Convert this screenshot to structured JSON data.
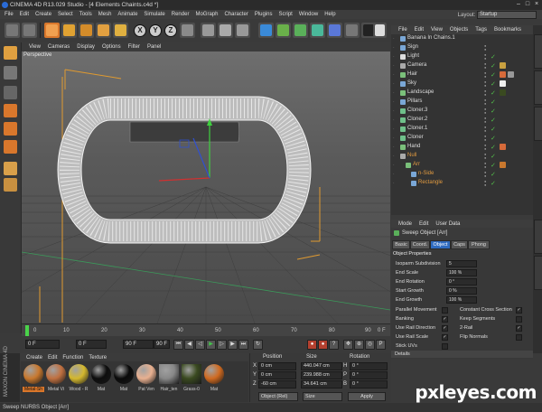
{
  "window": {
    "title": "CINEMA 4D R13.029 Studio - [4 Elements Chaints.c4d *]"
  },
  "menubar": {
    "items": [
      "File",
      "Edit",
      "Create",
      "Select",
      "Tools",
      "Mesh",
      "Animate",
      "Simulate",
      "Render",
      "MoGraph",
      "Character",
      "Plugins",
      "Script",
      "Window",
      "Help"
    ],
    "layout_label": "Layout:",
    "layout_value": "Startup"
  },
  "toolbar": {
    "axis_x": "X",
    "axis_y": "Y",
    "axis_z": "Z"
  },
  "viewport": {
    "menu": [
      "View",
      "Cameras",
      "Display",
      "Options",
      "Filter",
      "Panel"
    ],
    "label": "Perspective"
  },
  "timeline": {
    "ticks": [
      "0",
      "10",
      "20",
      "30",
      "40",
      "50",
      "60",
      "70",
      "80",
      "90"
    ],
    "end_marker": "0 F",
    "start_field": "0 F",
    "current_field": "0 F",
    "end_field": "90 F",
    "end_field2": "90 F"
  },
  "materials": {
    "menu": [
      "Create",
      "Edit",
      "Function",
      "Texture"
    ],
    "items": [
      {
        "name": "Metal-Sh",
        "color": "#c8782e",
        "selected": true
      },
      {
        "name": "Metal Vi",
        "color": "#c07040"
      },
      {
        "name": "Wood - R",
        "color": "#d4b82e"
      },
      {
        "name": "Mat",
        "color": "#0d0d0d"
      },
      {
        "name": "Mat",
        "color": "#0a0a0a"
      },
      {
        "name": "Pat Ven",
        "color": "#e8b090"
      },
      {
        "name": "Hair_ten",
        "color": "#888888"
      },
      {
        "name": "Grass-0",
        "color": "#3a4a20"
      },
      {
        "name": "Mat",
        "color": "#d06a20"
      }
    ],
    "brand": "MAXON CINEMA 4D"
  },
  "coordinates": {
    "headers": {
      "position": "Position",
      "size": "Size",
      "rotation": "Rotation"
    },
    "rows": [
      {
        "axis": "X",
        "pos": "0 cm",
        "size": "440.047 cm",
        "rot_axis": "H",
        "rot": "0 °"
      },
      {
        "axis": "Y",
        "pos": "0 cm",
        "size": "239.988 cm",
        "rot_axis": "P",
        "rot": "0 °"
      },
      {
        "axis": "Z",
        "pos": "-60 cm",
        "size": "34.641 cm",
        "rot_axis": "B",
        "rot": "0 °"
      }
    ],
    "mode_select": "Object (Rel)",
    "size_select": "Size",
    "apply_label": "Apply"
  },
  "status": {
    "text": "Sweep NURBS Object [Arr]"
  },
  "object_manager": {
    "menu": [
      "File",
      "Edit",
      "View",
      "Objects",
      "Tags",
      "Bookmarks"
    ],
    "objects": [
      {
        "name": "Banana In Chains.1",
        "indent": 0,
        "color": "#7aa7d6",
        "check": false
      },
      {
        "name": "Sign",
        "indent": 0,
        "color": "#7aa7d6",
        "check": false
      },
      {
        "name": "Light",
        "indent": 0,
        "color": "#ddd",
        "check": true
      },
      {
        "name": "Camera",
        "indent": 0,
        "color": "#aaa",
        "check": true
      },
      {
        "name": "Hair",
        "indent": 0,
        "color": "#7ac07a",
        "check": true
      },
      {
        "name": "Sky",
        "indent": 0,
        "color": "#7aa7d6",
        "check": true
      },
      {
        "name": "Landscape",
        "indent": 0,
        "color": "#7ac07a",
        "check": true
      },
      {
        "name": "Pillars",
        "indent": 0,
        "color": "#7aa7d6",
        "check": true
      },
      {
        "name": "Cloner.3",
        "indent": 0,
        "color": "#6fc08a",
        "check": true
      },
      {
        "name": "Cloner.2",
        "indent": 0,
        "color": "#6fc08a",
        "check": true
      },
      {
        "name": "Cloner.1",
        "indent": 0,
        "color": "#6fc08a",
        "check": true
      },
      {
        "name": "Cloner",
        "indent": 0,
        "color": "#6fc08a",
        "check": true
      },
      {
        "name": "Hand",
        "indent": 0,
        "color": "#7ac07a",
        "check": true
      },
      {
        "name": "Null",
        "indent": 0,
        "color": "#aaa",
        "check": true,
        "orange": true
      },
      {
        "name": "Arr",
        "indent": 1,
        "color": "#7ac07a",
        "check": true,
        "orange": true
      },
      {
        "name": "n-Side",
        "indent": 2,
        "color": "#7aa7d6",
        "check": true,
        "orange": true
      },
      {
        "name": "Rectangle",
        "indent": 2,
        "color": "#7aa7d6",
        "check": true,
        "orange": true
      }
    ]
  },
  "attributes": {
    "menu": [
      "Mode",
      "Edit",
      "User Data"
    ],
    "title": "Sweep Object [Arr]",
    "tabs": [
      "Basic",
      "Coord.",
      "Object",
      "Caps",
      "Phong"
    ],
    "selected_tab": "Object",
    "section": "Object Properties",
    "fields": [
      {
        "label": "Isoparm Subdivision",
        "value": "5"
      },
      {
        "label": "End Scale",
        "value": "100 %"
      },
      {
        "label": "End Rotation",
        "value": "0 °"
      },
      {
        "label": "Start Growth",
        "value": "0 %"
      },
      {
        "label": "End Growth",
        "value": "100 %"
      }
    ],
    "checks_left": [
      {
        "label": "Parallel Movement",
        "checked": false
      },
      {
        "label": "Banking",
        "checked": true
      },
      {
        "label": "Use Rail Direction",
        "checked": true
      },
      {
        "label": "Use Rail Scale",
        "checked": true
      },
      {
        "label": "Stick UVs",
        "checked": false
      }
    ],
    "checks_right": [
      {
        "label": "Constant Cross Section",
        "checked": true
      },
      {
        "label": "Keep Segments",
        "checked": false
      },
      {
        "label": "2-Rail",
        "checked": true
      },
      {
        "label": "Flip Normals",
        "checked": false
      }
    ],
    "details": "Details"
  },
  "watermark": "pxleyes.com"
}
